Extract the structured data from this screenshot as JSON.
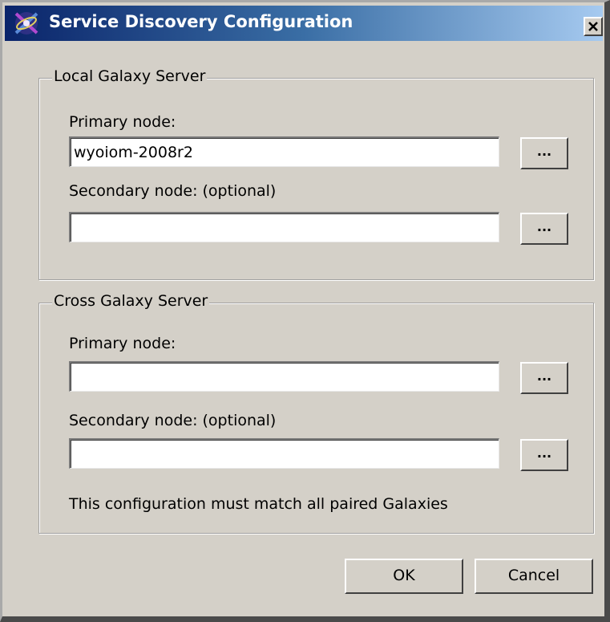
{
  "window": {
    "title": "Service Discovery Configuration",
    "app_icon": "satellite-dish-icon",
    "close_icon": "close-x-icon"
  },
  "local_group": {
    "legend": "Local Galaxy Server",
    "primary_label": "Primary node:",
    "primary_value": "wyoiom-2008r2",
    "secondary_label": "Secondary node: (optional)",
    "secondary_value": "",
    "browse_label": "..."
  },
  "cross_group": {
    "legend": "Cross Galaxy Server",
    "primary_label": "Primary node:",
    "primary_value": "",
    "secondary_label": "Secondary node: (optional)",
    "secondary_value": "",
    "browse_label": "...",
    "note": "This configuration must match all paired Galaxies"
  },
  "buttons": {
    "ok": "OK",
    "cancel": "Cancel"
  },
  "colors": {
    "title_gradient_start": "#0a246a",
    "title_gradient_end": "#a6caf0",
    "dialog_face": "#d4d0c8"
  }
}
